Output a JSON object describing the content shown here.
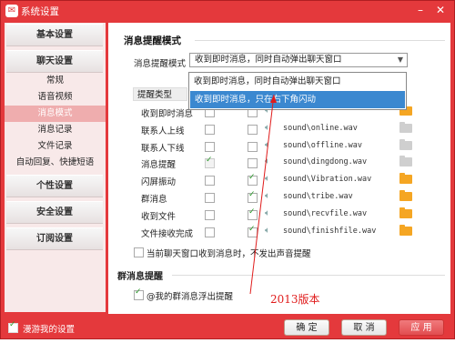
{
  "window": {
    "title": "系统设置",
    "min_icon": "minimize-icon",
    "close_icon": "close-icon"
  },
  "sidebar": {
    "basic": "基本设置",
    "chat": "聊天设置",
    "chat_items": [
      "常规",
      "语音视频",
      "消息模式",
      "消息记录",
      "文件记录",
      "自动回复、快捷短语"
    ],
    "personal": "个性设置",
    "security": "安全设置",
    "subscription": "订阅设置"
  },
  "content": {
    "section_title": "消息提醒模式",
    "mode_label": "消息提醒模式",
    "mode_value": "收到即时消息，同时自动弹出聊天窗口",
    "dropdown_options": [
      "收到即时消息，同时自动弹出聊天窗口",
      "收到即时消息，只在右下角闪动"
    ],
    "table_header": "提醒类型",
    "rows": [
      {
        "name": "收到即时消息",
        "path": "",
        "c1": false,
        "c2": false,
        "folder_on": true
      },
      {
        "name": "联系人上线",
        "path": "sound\\online.wav",
        "c1": false,
        "c2": false,
        "folder_on": false
      },
      {
        "name": "联系人下线",
        "path": "sound\\offline.wav",
        "c1": false,
        "c2": false,
        "folder_on": false
      },
      {
        "name": "消息提醒",
        "path": "sound\\dingdong.wav",
        "c1": true,
        "c2": false,
        "folder_on": false
      },
      {
        "name": "闪屏振动",
        "path": "sound\\Vibration.wav",
        "c1": false,
        "c2": true,
        "folder_on": true
      },
      {
        "name": "群消息",
        "path": "sound\\tribe.wav",
        "c1": false,
        "c2": true,
        "folder_on": true
      },
      {
        "name": "收到文件",
        "path": "sound\\recvfile.wav",
        "c1": false,
        "c2": true,
        "folder_on": true
      },
      {
        "name": "文件接收完成",
        "path": "sound\\finishfile.wav",
        "c1": false,
        "c2": true,
        "folder_on": true
      }
    ],
    "mute_text": "当前聊天窗口收到消息时，不发出声音提醒",
    "group_title": "群消息提醒",
    "group_option": "@我的群消息浮出提醒",
    "annotation": "2013版本"
  },
  "footer": {
    "roam": "漫游我的设置",
    "ok": "确 定",
    "cancel": "取 消",
    "apply": "应 用"
  }
}
